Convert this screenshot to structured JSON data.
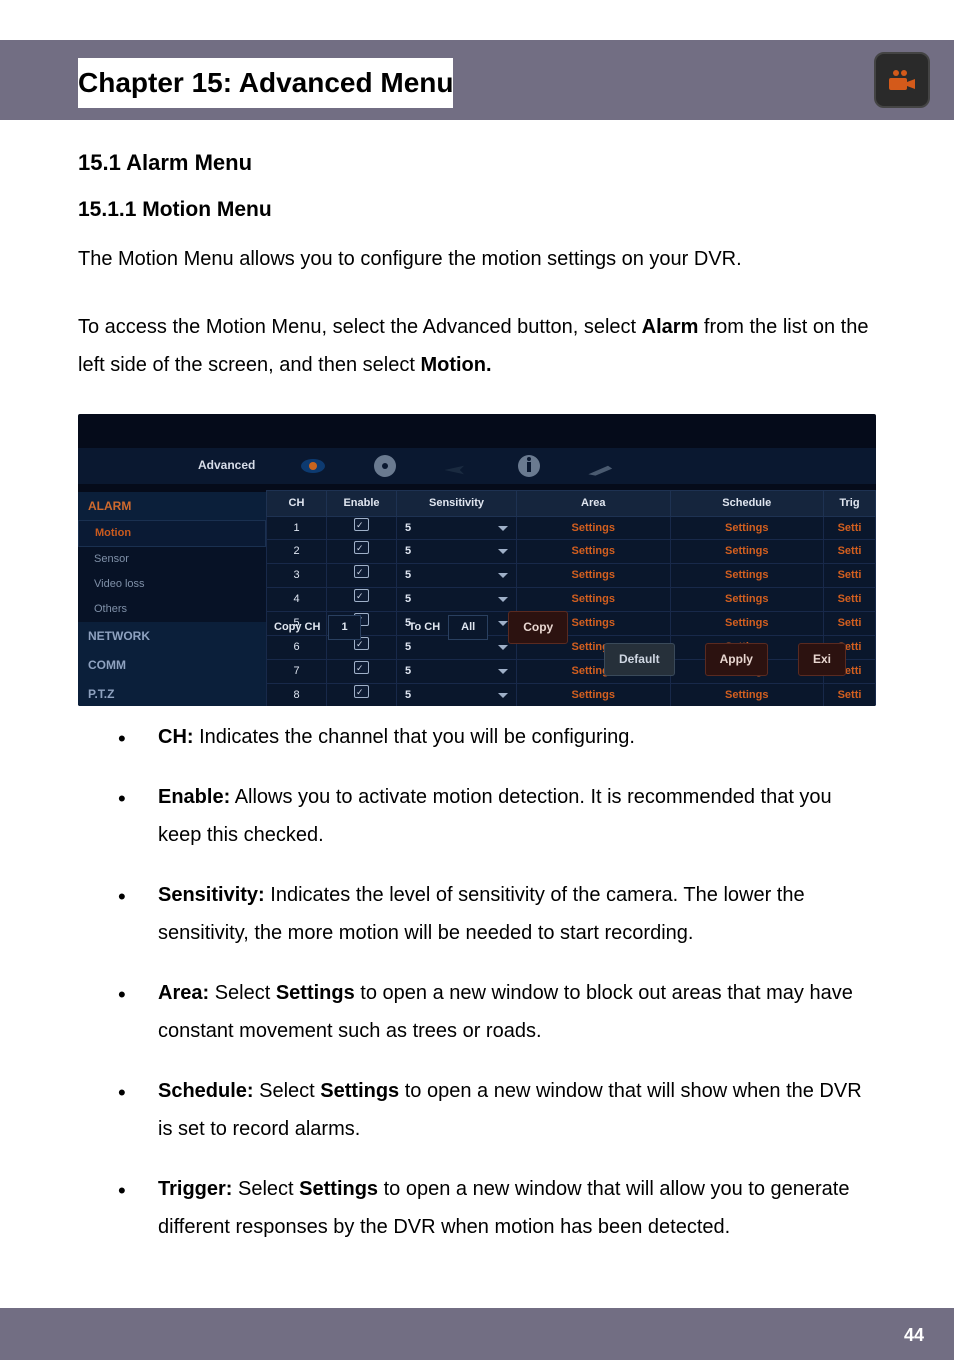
{
  "chapter_title": "Chapter 15: Advanced Menu",
  "section_1": "15.1 Alarm Menu",
  "section_1_1": "15.1.1 Motion Menu",
  "para_1": "The Motion Menu allows you to configure the motion settings on your DVR.",
  "para_2_pre": "To access the Motion Menu, select the Advanced button, select ",
  "para_2_b1": "Alarm",
  "para_2_mid": " from the list on the left side of the screen, and then select ",
  "para_2_b2": "Motion.",
  "screenshot": {
    "strip_label": "Advanced",
    "sidebar": {
      "header": "ALARM",
      "items": [
        "Motion",
        "Sensor",
        "Video loss",
        "Others"
      ],
      "section2": "NETWORK",
      "section3": "COMM",
      "section4": "P.T.Z"
    },
    "cols": [
      "CH",
      "Enable",
      "Sensitivity",
      "Area",
      "Schedule",
      "Trig"
    ],
    "rows": [
      {
        "ch": "1",
        "sens": "5"
      },
      {
        "ch": "2",
        "sens": "5"
      },
      {
        "ch": "3",
        "sens": "5"
      },
      {
        "ch": "4",
        "sens": "5"
      },
      {
        "ch": "5",
        "sens": "5"
      },
      {
        "ch": "6",
        "sens": "5"
      },
      {
        "ch": "7",
        "sens": "5"
      },
      {
        "ch": "8",
        "sens": "5"
      }
    ],
    "cell_settings": "Settings",
    "cell_setti": "Setti",
    "copy_row": {
      "label": "Copy CH",
      "from": "1",
      "to_label": "To CH",
      "to": "All",
      "btn": "Copy"
    },
    "btn_default": "Default",
    "btn_apply": "Apply",
    "btn_exit": "Exi"
  },
  "bullets": [
    {
      "term": "CH:",
      "text": " Indicates the channel that you will be configuring."
    },
    {
      "term": "Enable:",
      "text": " Allows you to activate motion detection. It is recommended that you keep this checked."
    },
    {
      "term": "Sensitivity:",
      "text": " Indicates the level of sensitivity of the camera. The lower the sensitivity, the more motion will be needed to start recording."
    },
    {
      "term": "Area:",
      "pre": " Select ",
      "bold": "Settings",
      "text": " to open a new window to block out areas that may have constant movement such as trees or roads."
    },
    {
      "term": "Schedule:",
      "pre": " Select ",
      "bold": "Settings",
      "text": " to open a new window that will show when the DVR is set to record alarms."
    },
    {
      "term": "Trigger:",
      "pre": " Select ",
      "bold": "Settings",
      "text": " to open a new window that will allow you to generate different responses by the DVR when motion has been detected."
    }
  ],
  "page_number": "44"
}
